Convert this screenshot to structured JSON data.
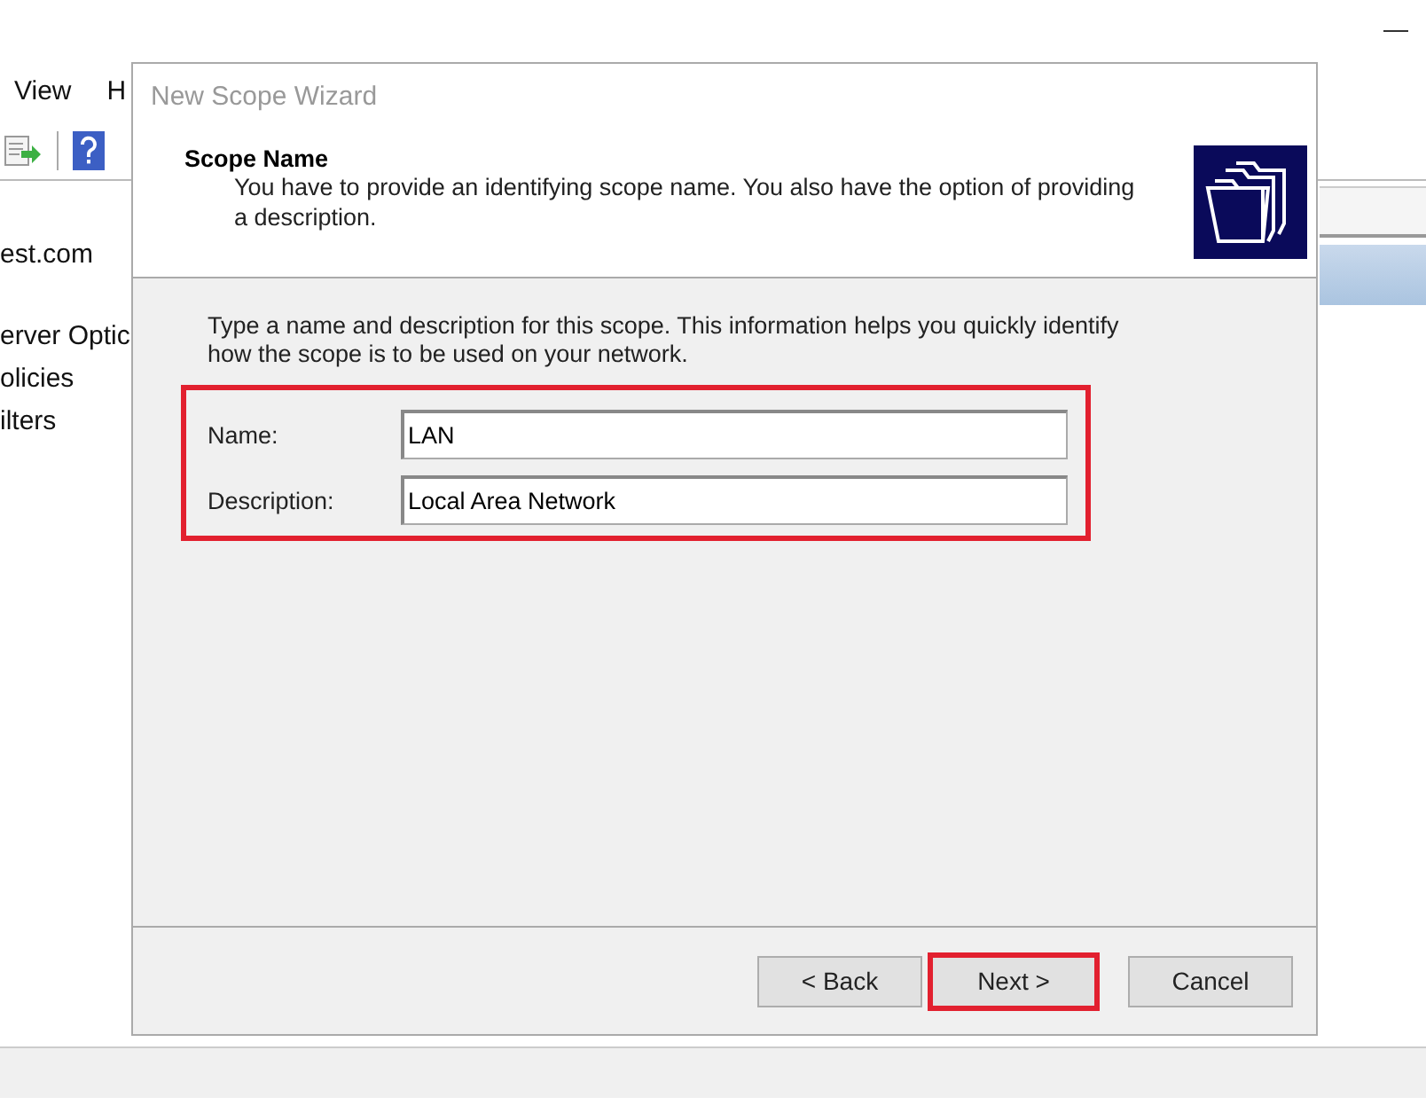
{
  "menu": [
    "View",
    "H"
  ],
  "tree": [
    "est.com",
    "erver Optic",
    "olicies",
    "ilters"
  ],
  "dialog": {
    "title": "New Scope Wizard",
    "heading": "Scope Name",
    "subtitle": "You have to provide an identifying scope name. You also have the option of providing a description.",
    "instructions": "Type a name and description for this scope. This information helps you quickly identify how the scope is to be used on your network.",
    "fields_highlighted": true,
    "fields": [
      {
        "label": "Name:",
        "value": "LAN"
      },
      {
        "label": "Description:",
        "value": "Local Area Network"
      }
    ],
    "buttons": [
      {
        "label": "< Back",
        "highlighted": false
      },
      {
        "label": "Next >",
        "highlighted": true
      },
      {
        "label": "Cancel",
        "highlighted": false
      }
    ]
  }
}
